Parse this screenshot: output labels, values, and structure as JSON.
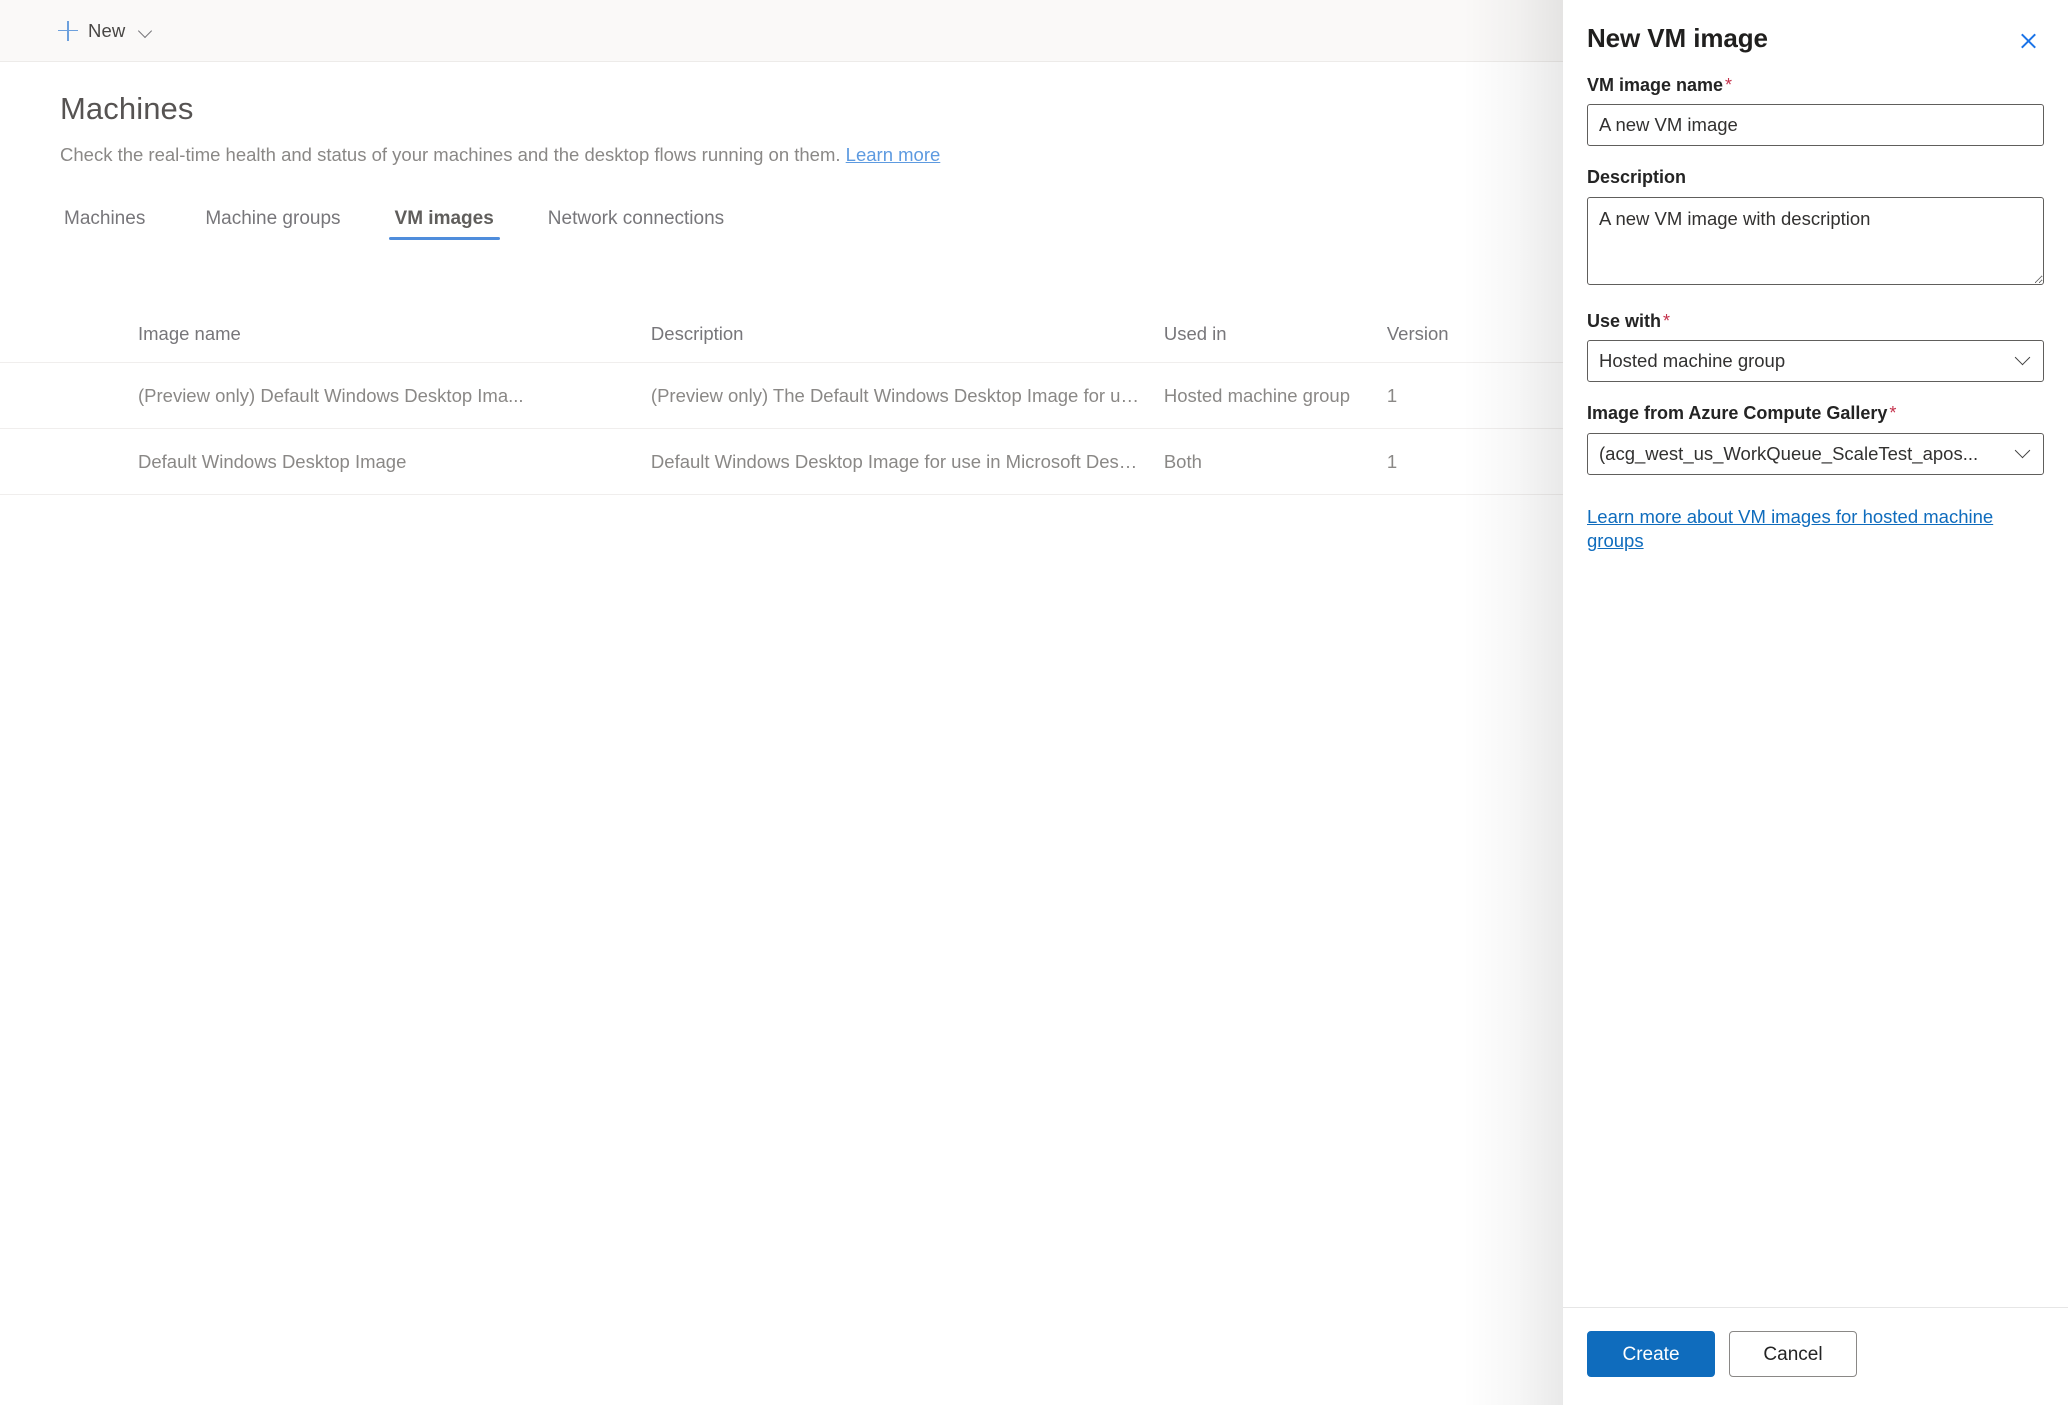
{
  "command_bar": {
    "new_label": "New",
    "plus_icon": "plus-icon",
    "chevron_icon": "chevron-down-icon"
  },
  "page": {
    "title": "Machines",
    "subtitle": "Check the real-time health and status of your machines and the desktop flows running on them.",
    "subtitle_link": "Learn more"
  },
  "tabs": [
    {
      "label": "Machines",
      "selected": false
    },
    {
      "label": "Machine groups",
      "selected": false
    },
    {
      "label": "VM images",
      "selected": true
    },
    {
      "label": "Network connections",
      "selected": false
    }
  ],
  "table": {
    "columns": [
      "Image name",
      "Description",
      "Used in",
      "Version"
    ],
    "rows": [
      {
        "image_name": "(Preview only) Default Windows Desktop Ima...",
        "description": "(Preview only) The Default Windows Desktop Image for use i...",
        "used_in": "Hosted machine group",
        "version": "1"
      },
      {
        "image_name": "Default Windows Desktop Image",
        "description": "Default Windows Desktop Image for use in Microsoft Deskto...",
        "used_in": "Both",
        "version": "1"
      }
    ]
  },
  "panel": {
    "title": "New VM image",
    "close_icon": "close-icon",
    "fields": {
      "name": {
        "label": "VM image name",
        "required_marker": "*",
        "value": "A new VM image"
      },
      "description": {
        "label": "Description",
        "value": "A new VM image with description"
      },
      "use_with": {
        "label": "Use with",
        "required_marker": "*",
        "value": "Hosted machine group",
        "chevron_icon": "chevron-down-icon"
      },
      "gallery_image": {
        "label": "Image from Azure Compute Gallery",
        "required_marker": "*",
        "value": "(acg_west_us_WorkQueue_ScaleTest_apos...",
        "chevron_icon": "chevron-down-icon"
      }
    },
    "help_link": "Learn more about VM images for hosted machine groups",
    "footer": {
      "primary_label": "Create",
      "secondary_label": "Cancel"
    }
  },
  "colors": {
    "accent_blue": "#0f6cbd",
    "tab_underline": "#4f8ddc",
    "link_blue": "#5d9ae0",
    "required_red": "#c4314b",
    "command_bar_bg": "#faf9f8"
  }
}
